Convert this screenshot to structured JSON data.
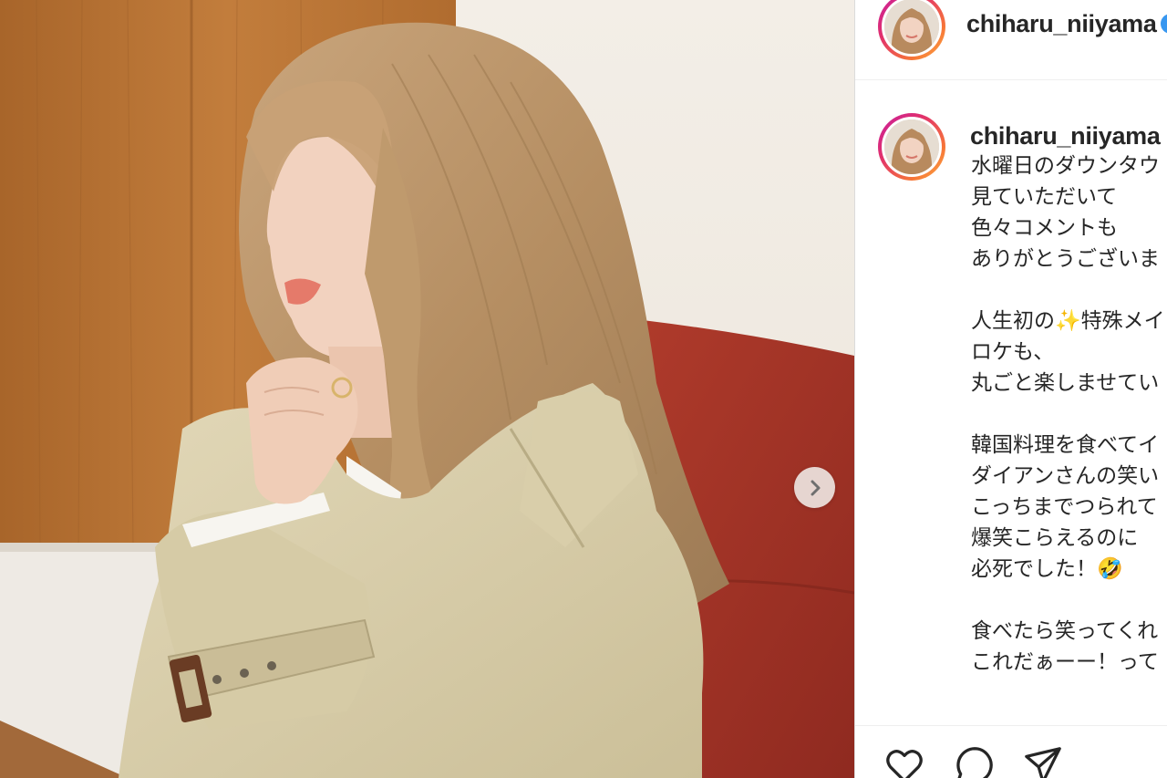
{
  "post": {
    "username": "chiharu_niiyama",
    "verified": true,
    "caption_lines": [
      "水曜日のダウンタウ",
      "見ていただいて",
      "色々コメントも",
      "ありがとうございま",
      "",
      "人生初の✨特殊メイ",
      "ロケも、",
      "丸ごと楽しませてい",
      "",
      "韓国料理を食べてイ",
      "ダイアンさんの笑い",
      "こっちまでつられて",
      "爆笑こらえるのに",
      "必死でした！🤣",
      "",
      "食べたら笑ってくれ",
      "これだぁーー！って"
    ]
  },
  "icons": {
    "next": "chevron-right-icon",
    "like": "heart-icon",
    "comment": "comment-bubble-icon",
    "share": "paper-plane-icon",
    "verified": "verified-badge-icon"
  },
  "colors": {
    "text": "#262626",
    "border": "#dbdbdb",
    "verified": "#3897f0",
    "story_ring_start": "#c71fa0",
    "story_ring_end": "#fcaf45"
  }
}
